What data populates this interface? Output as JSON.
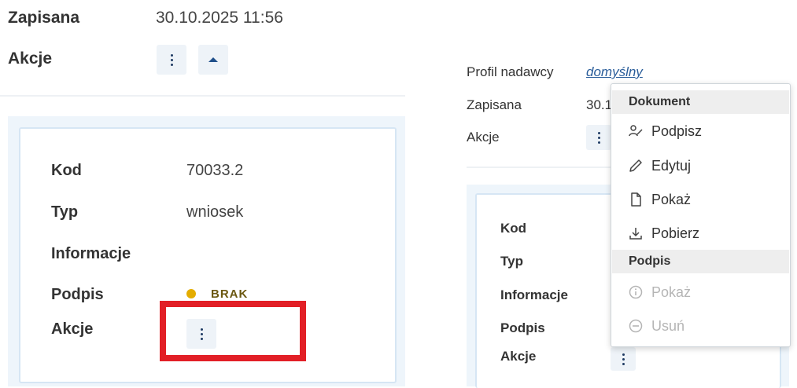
{
  "left": {
    "zapisana_label": "Zapisana",
    "zapisana_value": "30.10.2025 11:56",
    "akcje_label": "Akcje",
    "card": {
      "kod_label": "Kod",
      "kod_value": "70033.2",
      "typ_label": "Typ",
      "typ_value": "wniosek",
      "informacje_label": "Informacje",
      "podpis_label": "Podpis",
      "podpis_status": "BRAK",
      "podpis_status_color": "#e4ad00",
      "akcje_label": "Akcje"
    },
    "highlight_color": "#e21f26"
  },
  "right": {
    "profil_label": "Profil nadawcy",
    "profil_value": "domyślny",
    "zapisana_label": "Zapisana",
    "zapisana_value_partial": "30.1",
    "akcje_label": "Akcje",
    "card": {
      "kod_label": "Kod",
      "typ_label": "Typ",
      "informacje_label": "Informacje",
      "podpis_label": "Podpis",
      "akcje_label": "Akcje"
    }
  },
  "menu": {
    "section_dokument": "Dokument",
    "items_dokument": [
      {
        "label": "Podpisz",
        "icon": "sign-icon"
      },
      {
        "label": "Edytuj",
        "icon": "pencil-icon"
      },
      {
        "label": "Pokaż",
        "icon": "file-icon"
      },
      {
        "label": "Pobierz",
        "icon": "download-icon"
      }
    ],
    "section_podpis": "Podpis",
    "items_podpis": [
      {
        "label": "Pokaż",
        "icon": "info-icon",
        "disabled": true
      },
      {
        "label": "Usuń",
        "icon": "minus-circle-icon",
        "disabled": true
      }
    ]
  },
  "colors": {
    "accent": "#1f4f8a",
    "link": "#2a5d9a",
    "button_bg": "#eef3f8"
  }
}
